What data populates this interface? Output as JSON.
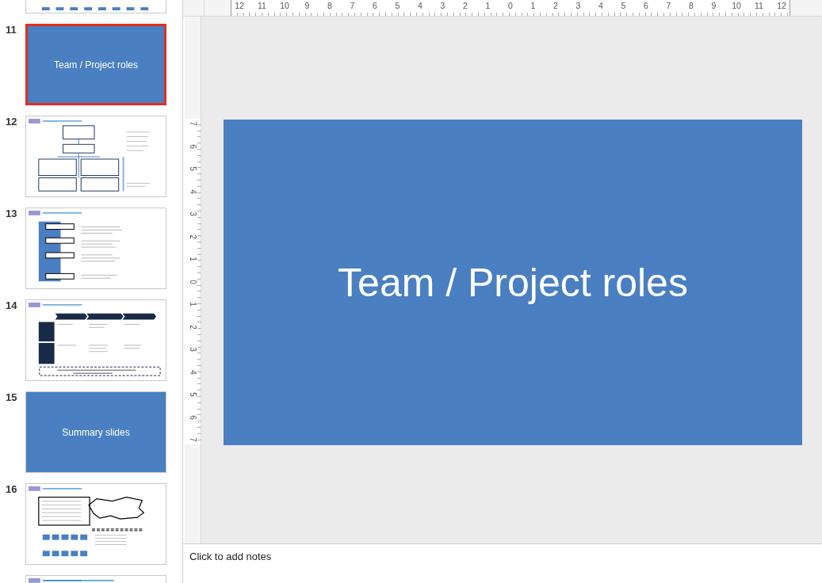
{
  "slides": [
    {
      "kind": "strip",
      "selected": false
    },
    {
      "number": "11",
      "kind": "title",
      "title": "Team / Project roles",
      "selected": true
    },
    {
      "number": "12",
      "kind": "org",
      "selected": false
    },
    {
      "number": "13",
      "kind": "roles",
      "selected": false
    },
    {
      "number": "14",
      "kind": "table",
      "selected": false
    },
    {
      "number": "15",
      "kind": "title",
      "title": "Summary slides",
      "selected": false
    },
    {
      "number": "16",
      "kind": "country",
      "selected": false
    },
    {
      "kind": "strip",
      "selected": false
    }
  ],
  "ruler": {
    "horizontal": [
      "12",
      "11",
      "10",
      "9",
      "8",
      "7",
      "6",
      "5",
      "4",
      "3",
      "2",
      "1",
      "0",
      "1",
      "2",
      "3",
      "4",
      "5",
      "6",
      "7",
      "8",
      "9",
      "10",
      "11",
      "12"
    ],
    "vertical": [
      "7",
      "6",
      "5",
      "4",
      "3",
      "2",
      "1",
      "0",
      "1",
      "2",
      "3",
      "4",
      "5",
      "6",
      "7"
    ]
  },
  "slide": {
    "title": "Team / Project roles"
  },
  "notes": {
    "placeholder": "Click to add notes"
  }
}
